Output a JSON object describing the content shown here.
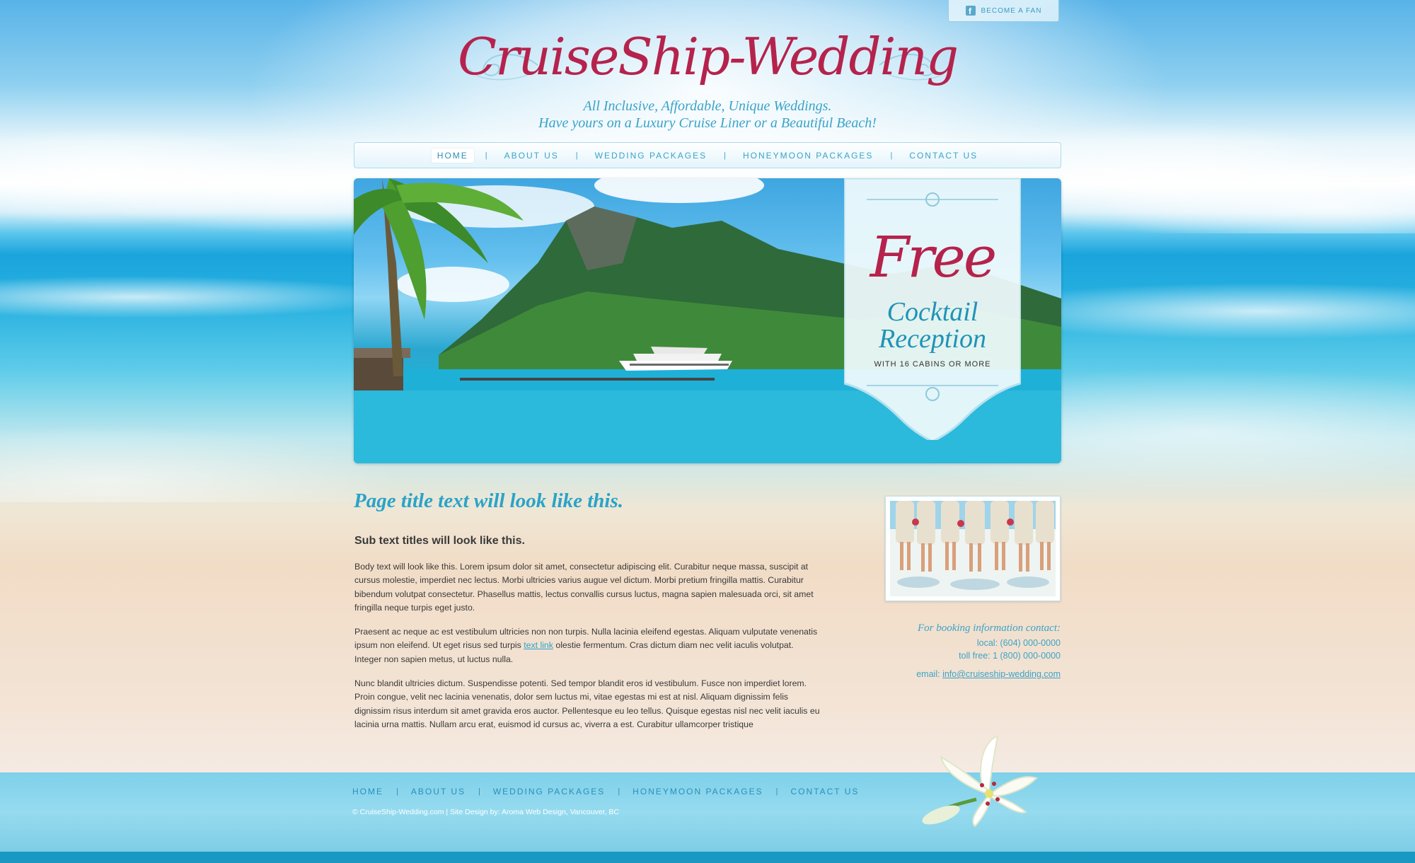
{
  "top": {
    "fan_button": "BECOME A FAN",
    "fan_icon": "facebook-icon"
  },
  "header": {
    "logo": "CruiseShip-Wedding",
    "tagline_1": "All Inclusive, Affordable, Unique Weddings.",
    "tagline_2": "Have yours on a Luxury Cruise Liner or a Beautiful Beach!"
  },
  "nav": {
    "items": [
      {
        "label": "HOME",
        "active": true
      },
      {
        "label": "ABOUT US"
      },
      {
        "label": "WEDDING PACKAGES"
      },
      {
        "label": "HONEYMOON PACKAGES"
      },
      {
        "label": "CONTACT US"
      }
    ],
    "separator": "|"
  },
  "hero": {
    "promo_free": "Free",
    "promo_line1": "Cocktail",
    "promo_line2": "Reception",
    "promo_sub": "WITH 16 CABINS OR MORE"
  },
  "content": {
    "page_title": "Page title text will look like this.",
    "sub_title": "Sub text titles will look like this.",
    "p1": "Body text will look like this. Lorem ipsum dolor sit amet, consectetur adipiscing elit. Curabitur neque massa, suscipit at cursus molestie, imperdiet nec lectus. Morbi ultricies varius augue vel dictum. Morbi pretium fringilla mattis. Curabitur bibendum volutpat consectetur. Phasellus mattis, lectus convallis cursus luctus, magna sapien malesuada orci, sit amet fringilla neque turpis eget justo.",
    "p2_before": "Praesent ac neque ac est vestibulum ultricies non non turpis. Nulla lacinia eleifend egestas. Aliquam vulputate venenatis ipsum non eleifend. Ut eget risus sed turpis ",
    "p2_link": "text link",
    "p2_after": " olestie fermentum. Cras dictum diam nec velit iaculis volutpat. Integer non sapien metus, ut luctus nulla.",
    "p3": "Nunc blandit ultricies dictum. Suspendisse potenti. Sed tempor blandit eros id vestibulum. Fusce non imperdiet lorem. Proin congue, velit nec lacinia venenatis, dolor sem luctus mi, vitae egestas mi est at nisl. Aliquam dignissim felis dignissim risus interdum sit amet gravida eros auctor. Pellentesque eu leo tellus. Quisque egestas nisl nec velit iaculis eu lacinia urna mattis. Nullam arcu erat, euismod id cursus ac, viverra a est. Curabitur ullamcorper tristique"
  },
  "contact": {
    "heading": "For booking information contact:",
    "local": "local: (604) 000-0000",
    "tollfree": "toll free: 1 (800) 000-0000",
    "email_label": "email: ",
    "email": "info@cruiseship-wedding.com"
  },
  "footer": {
    "items": [
      "HOME",
      "ABOUT US",
      "WEDDING PACKAGES",
      "HONEYMOON PACKAGES",
      "CONTACT US"
    ],
    "separator": "|",
    "copyright": "© CruiseShip-Wedding.com  |  Site Design by: Aroma Web Design, Vancouver, BC"
  },
  "colors": {
    "accent_red": "#b5234c",
    "accent_blue": "#2aa3c8",
    "footer_bar": "#1a98c4"
  }
}
